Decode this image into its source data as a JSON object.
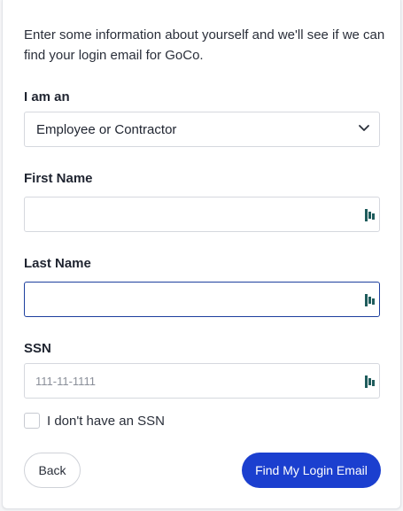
{
  "intro": "Enter some information about yourself and we'll see if we can find your login email for GoCo.",
  "role": {
    "label": "I am an",
    "selected": "Employee or Contractor"
  },
  "first_name": {
    "label": "First Name",
    "value": "",
    "placeholder": ""
  },
  "last_name": {
    "label": "Last Name",
    "value": "",
    "placeholder": ""
  },
  "ssn": {
    "label": "SSN",
    "value": "",
    "placeholder": "111-11-1111"
  },
  "no_ssn": {
    "label": "I don't have an SSN",
    "checked": false
  },
  "buttons": {
    "back": "Back",
    "find": "Find My Login Email"
  },
  "colors": {
    "primary": "#1b3fcf",
    "focus_border": "#1d3f9e",
    "password_manager_icon": "#1f5c5c"
  },
  "icons": {
    "select": "chevron-down-icon",
    "field": "password-manager-icon"
  }
}
